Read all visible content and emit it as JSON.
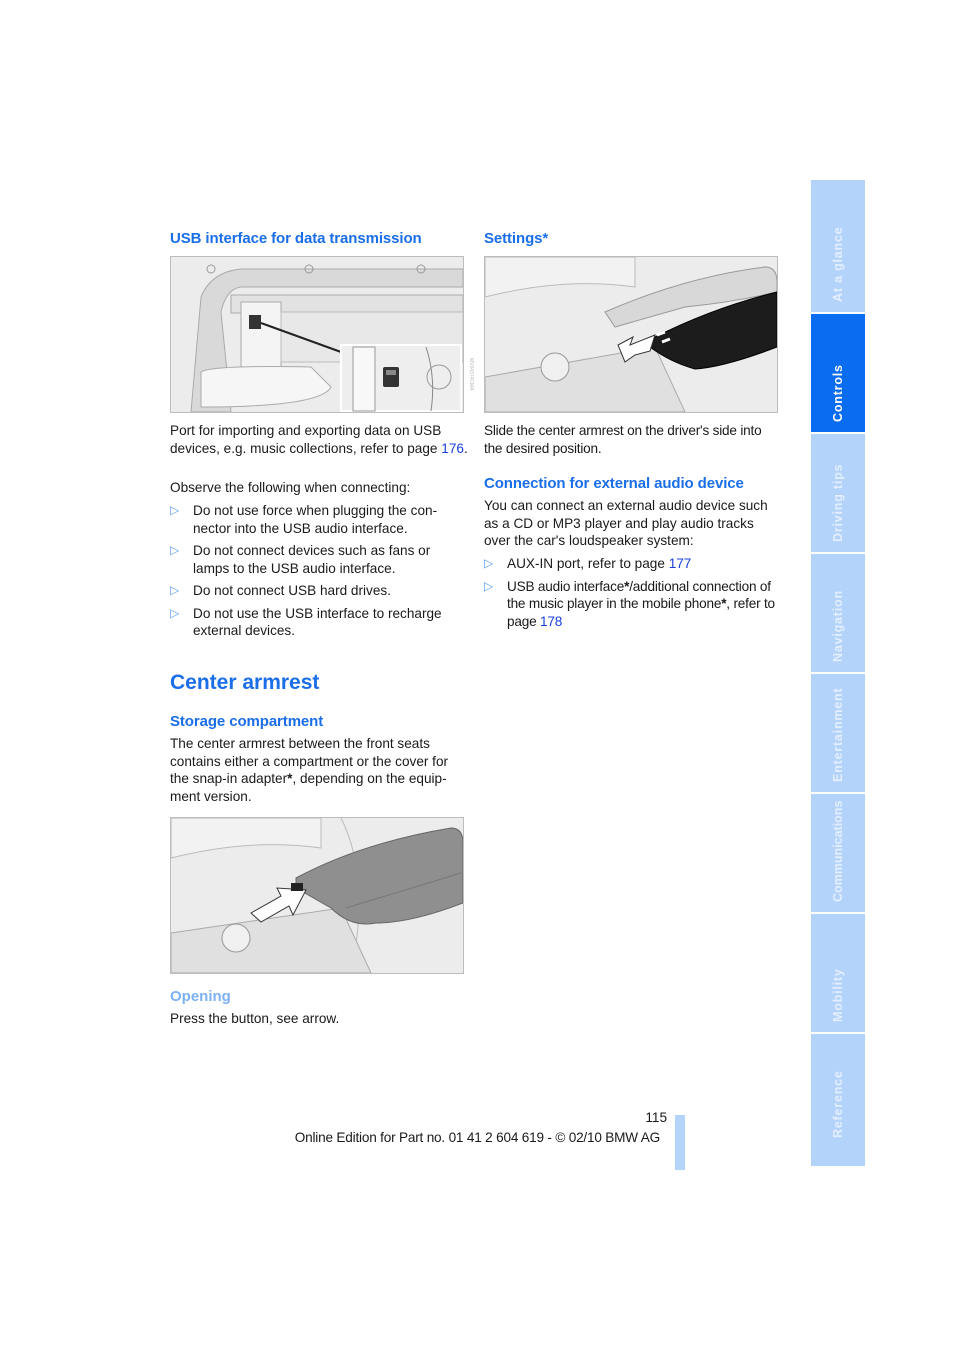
{
  "left_column": {
    "usb_heading": "USB interface for data transmission",
    "usb_figure_caption_id": "MV04374CMA",
    "usb_intro": {
      "text_before": "Port for importing and exporting data on USB devices, e.g. music collections, refer to page ",
      "link": "176",
      "text_after": "."
    },
    "observe_text": "Observe the following when connecting:",
    "bullets": [
      "Do not use force when plugging the con-nector into the USB audio interface.",
      "Do not connect devices such as fans or lamps to the USB audio interface.",
      "Do not connect USB hard drives.",
      "Do not use the USB interface to recharge external devices."
    ],
    "center_armrest_heading": "Center armrest",
    "storage_heading": "Storage compartment",
    "storage_text_before": "The center armrest between the front seats contains either a compartment or the cover for the snap-in adapter",
    "storage_asterisk": "*",
    "storage_text_after": ", depending on the equip-ment version.",
    "opening_heading": "Opening",
    "opening_text": "Press the button, see arrow."
  },
  "right_column": {
    "settings_heading": "Settings*",
    "settings_text": "Slide the center armrest on the driver's side into the desired position.",
    "audio_heading": "Connection for external audio device",
    "audio_text": "You can connect an external audio device such as a CD or MP3 player and play audio tracks over the car's loudspeaker system:",
    "audio_bullets": [
      {
        "text": "AUX-IN port, refer to page ",
        "link": "177"
      },
      {
        "text_before": "USB audio interface",
        "ast1": "*",
        "text_mid": "/additional connection of the music player in the mobile phone",
        "ast2": "*",
        "text_after": ", refer to page ",
        "link": "178"
      }
    ]
  },
  "sidebar": {
    "tabs": [
      {
        "label": "At a glance",
        "active": false
      },
      {
        "label": "Controls",
        "active": true
      },
      {
        "label": "Driving tips",
        "active": false
      },
      {
        "label": "Navigation",
        "active": false
      },
      {
        "label": "Entertainment",
        "active": false
      },
      {
        "label": "Communications",
        "active": false
      },
      {
        "label": "Mobility",
        "active": false
      },
      {
        "label": "Reference",
        "active": false
      }
    ]
  },
  "footer": {
    "page_number": "115",
    "edition": "Online Edition for Part no. 01 41 2 604 619 - © 02/10 BMW AG"
  },
  "colors": {
    "heading_blue": "#1a6ee8",
    "link_blue": "#1a3fe0",
    "sidebar_inactive": "#b3d3fb",
    "sidebar_active": "#0a6cf0",
    "subheading_light_blue": "#7db2f5"
  }
}
